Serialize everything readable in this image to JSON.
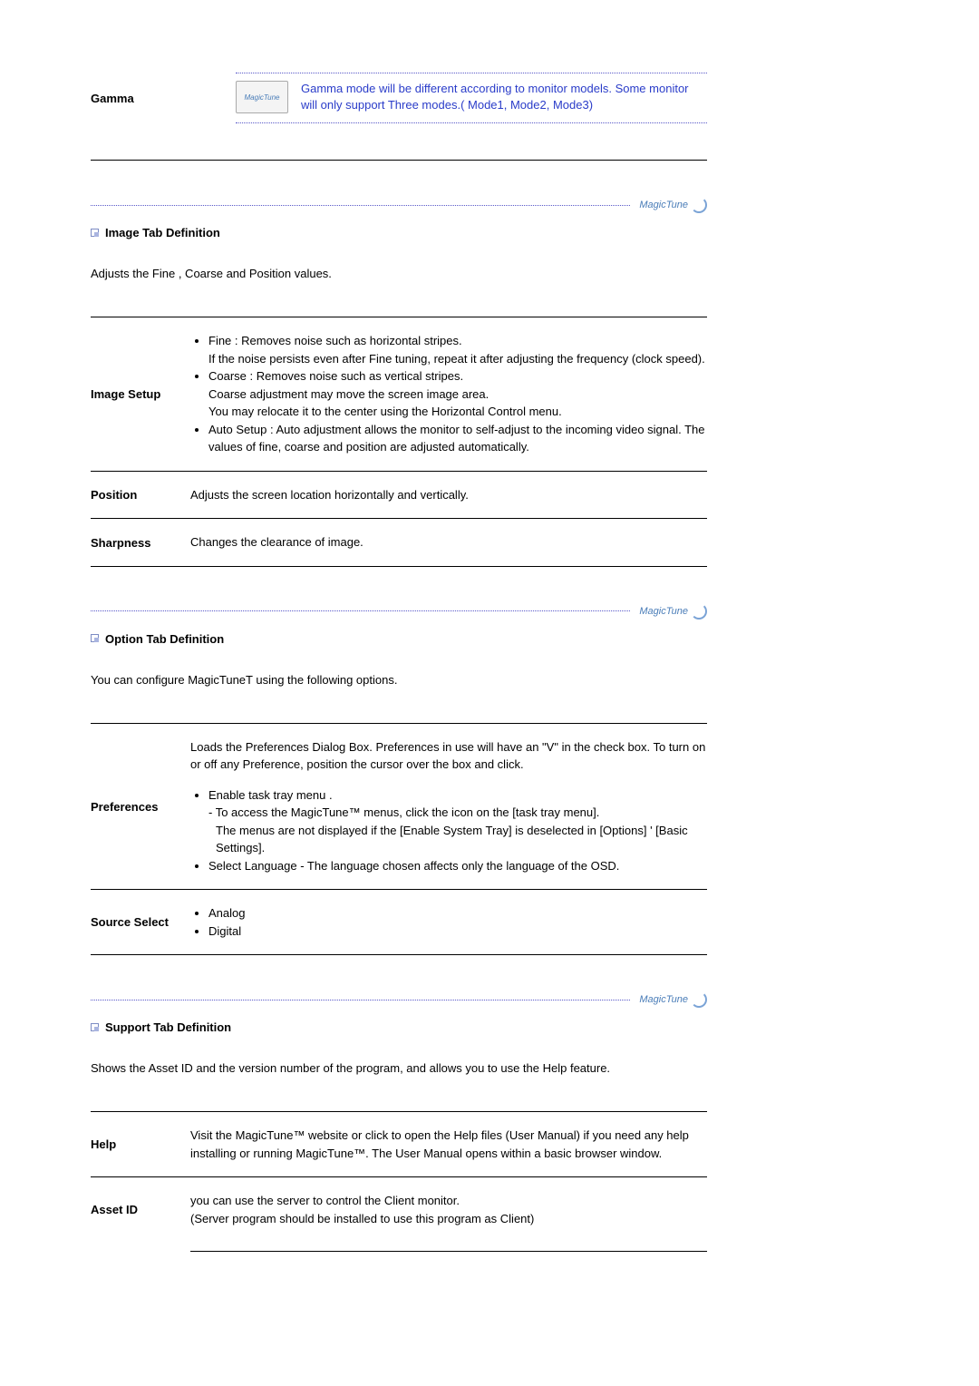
{
  "gamma": {
    "label": "Gamma",
    "logo_text": "MagicTune",
    "note": "Gamma mode will be different according to monitor models. Some monitor will only support Three modes.( Mode1, Mode2, Mode3)"
  },
  "logo_small": "MagicTune",
  "image_tab": {
    "heading": "Image Tab Definition",
    "desc": "Adjusts the Fine , Coarse and Position values.",
    "rows": {
      "image_setup": {
        "label": "Image Setup",
        "b1": "Fine : Removes noise such as horizontal stripes.",
        "b1_cont1": "If the noise persists even after Fine tuning, repeat it after adjusting the frequency (clock speed).",
        "b2": "Coarse : Removes noise such as vertical stripes.",
        "b2_cont1": "Coarse adjustment may move the screen image area.",
        "b2_cont2": "You may relocate it to the center using the Horizontal Control menu.",
        "b3": "Auto Setup : Auto adjustment allows the monitor to self-adjust to the incoming video signal. The values of fine, coarse and position are adjusted automatically."
      },
      "position": {
        "label": "Position",
        "text": "Adjusts the screen location horizontally and vertically."
      },
      "sharpness": {
        "label": "Sharpness",
        "text": "Changes the clearance of image."
      }
    }
  },
  "option_tab": {
    "heading": "Option Tab Definition",
    "desc": "You can configure MagicTuneT using the following options.",
    "rows": {
      "preferences": {
        "label": "Preferences",
        "intro": "Loads the Preferences Dialog Box. Preferences in use will have an \"V\" in the check box. To turn on or off any Preference, position the cursor over the box and click.",
        "b1": "Enable task tray menu .",
        "b1_sub1": "- To access the MagicTune™ menus, click the icon on the [task tray menu].",
        "b1_sub2": "The menus are not displayed if the [Enable System Tray] is deselected in [Options] ' [Basic Settings].",
        "b2": "Select Language - The language chosen affects only the language of the OSD."
      },
      "source_select": {
        "label": "Source Select",
        "b1": "Analog",
        "b2": "Digital"
      }
    }
  },
  "support_tab": {
    "heading": "Support Tab Definition",
    "desc": "Shows the Asset ID and the version number of the program, and allows you to use the Help feature.",
    "rows": {
      "help": {
        "label": "Help",
        "text": "Visit the MagicTune™ website or click to open the Help files (User Manual) if you need any help installing or running MagicTune™. The User Manual opens within a basic browser window."
      },
      "asset_id": {
        "label": "Asset ID",
        "text1": "you can use the server to control the Client monitor.",
        "text2": "(Server program should be installed to use this program as Client)"
      }
    }
  }
}
